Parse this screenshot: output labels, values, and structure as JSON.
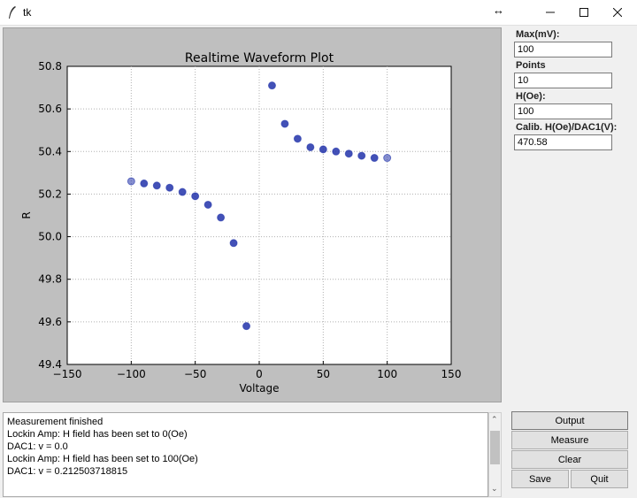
{
  "window": {
    "title": "tk"
  },
  "plot": {
    "colors": {
      "background": "#bfbfbf",
      "axes": "#ffffff",
      "marker": "#2233aa"
    }
  },
  "chart_data": {
    "type": "scatter",
    "title": "Realtime Waveform Plot",
    "xlabel": "Voltage",
    "ylabel": "R",
    "xlim": [
      -150,
      150
    ],
    "ylim": [
      49.4,
      50.8
    ],
    "grid": true,
    "xticks": [
      "−150",
      "−100",
      "−50",
      "0",
      "50",
      "100",
      "150"
    ],
    "yticks": [
      "49.4",
      "49.6",
      "49.8",
      "50.0",
      "50.2",
      "50.4",
      "50.6",
      "50.8"
    ],
    "x": [
      -100,
      -90,
      -80,
      -70,
      -60,
      -50,
      -40,
      -30,
      -20,
      -10,
      10,
      20,
      30,
      40,
      50,
      60,
      70,
      80,
      90,
      100
    ],
    "y": [
      50.26,
      50.25,
      50.24,
      50.23,
      50.21,
      50.19,
      50.15,
      50.09,
      49.97,
      49.58,
      50.71,
      50.53,
      50.46,
      50.42,
      50.41,
      50.4,
      50.39,
      50.38,
      50.37,
      50.37
    ]
  },
  "controls": {
    "max_mv": {
      "label": "Max(mV):",
      "value": "100"
    },
    "points": {
      "label": "Points",
      "value": "10"
    },
    "h_oe": {
      "label": "H(Oe):",
      "value": "100"
    },
    "calib": {
      "label": "Calib. H(Oe)/DAC1(V):",
      "value": "470.58"
    }
  },
  "log": {
    "lines": [
      "Measurement finished",
      "Lockin Amp: H field has been set to 0(Oe)",
      "DAC1: v = 0.0",
      "Lockin Amp: H field has been set to 100(Oe)",
      "DAC1: v = 0.212503718815"
    ]
  },
  "buttons": {
    "output": "Output",
    "measure": "Measure",
    "clear": "Clear",
    "save": "Save",
    "quit": "Quit"
  }
}
